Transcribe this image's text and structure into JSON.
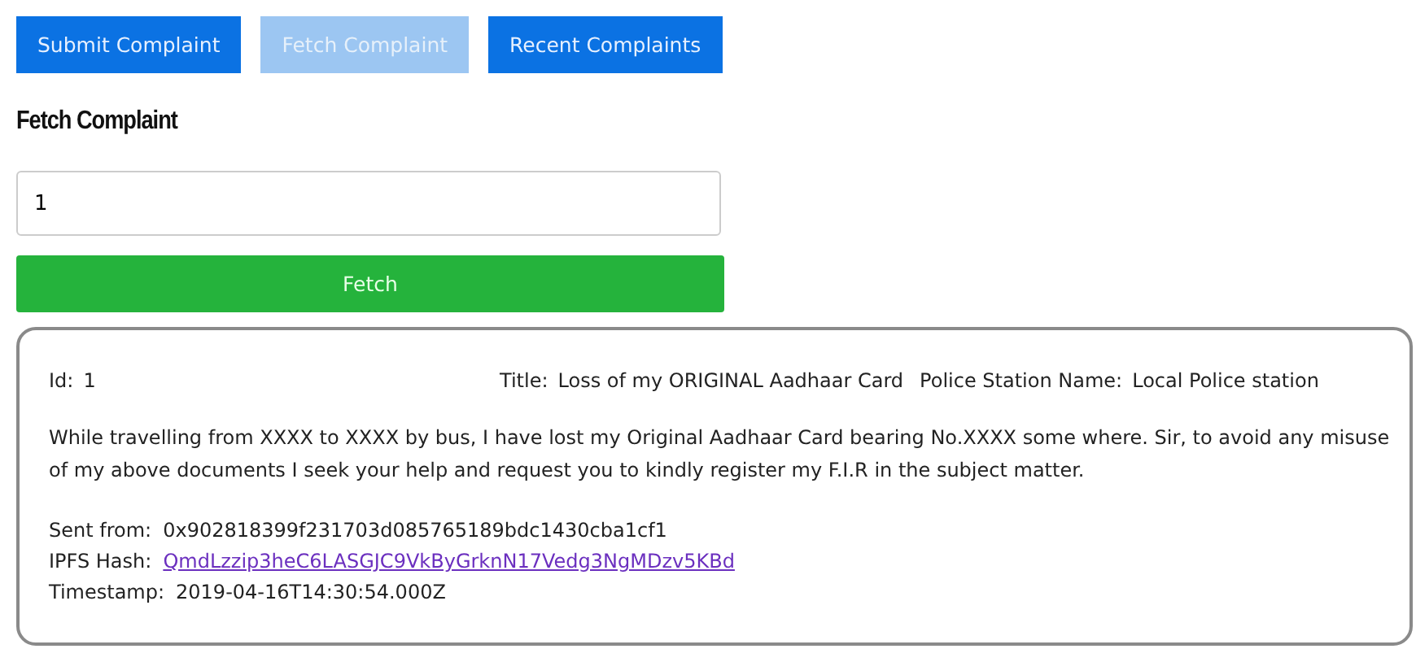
{
  "tabs": [
    {
      "label": "Submit Complaint",
      "selected": false
    },
    {
      "label": "Fetch Complaint",
      "selected": true
    },
    {
      "label": "Recent Complaints",
      "selected": false
    }
  ],
  "heading": "Fetch Complaint",
  "id_field": {
    "value": "1"
  },
  "fetch_button": "Fetch",
  "complaint": {
    "header": [
      {
        "label": "Id:",
        "value": "1"
      },
      {
        "label": "Title:",
        "value": "Loss of my ORIGINAL Aadhaar Card"
      },
      {
        "label": "Police Station Name:",
        "value": "Local Police station"
      }
    ],
    "description": "While travelling from XXXX to XXXX by bus, I have lost my Original Aadhaar Card bearing No.XXXX some where. Sir, to avoid any misuse of my above documents I seek your help and request you to kindly register my F.I.R in the subject matter.",
    "details": [
      {
        "label": "Sent from:",
        "value": "0x902818399f231703d085765189bdc1430cba1cf1",
        "kind": "text"
      },
      {
        "label": "IPFS Hash:",
        "value": "QmdLzzip3heC6LASGJC9VkByGrknN17Vedg3NgMDzv5KBd",
        "kind": "link"
      },
      {
        "label": "Timestamp:",
        "value": "2019-04-16T14:30:54.000Z",
        "kind": "text"
      }
    ]
  }
}
